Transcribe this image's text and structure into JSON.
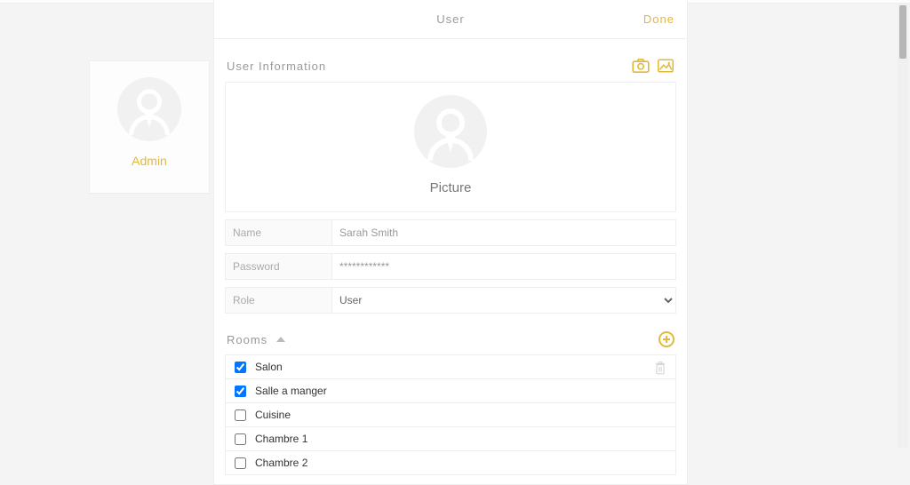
{
  "header": {
    "title": "User",
    "done_label": "Done"
  },
  "sidebar": {
    "role_label": "Admin"
  },
  "user_info": {
    "section_title": "User Information",
    "picture_caption": "Picture",
    "fields": {
      "name_label": "Name",
      "name_value": "Sarah Smith",
      "password_label": "Password",
      "password_value": "************",
      "role_label": "Role",
      "role_value": "User"
    }
  },
  "rooms": {
    "section_title": "Rooms",
    "items": [
      {
        "label": "Salon",
        "checked": true,
        "show_trash": true
      },
      {
        "label": "Salle a manger",
        "checked": true,
        "show_trash": false
      },
      {
        "label": "Cuisine",
        "checked": false,
        "show_trash": false
      },
      {
        "label": "Chambre 1",
        "checked": false,
        "show_trash": false
      },
      {
        "label": "Chambre 2",
        "checked": false,
        "show_trash": false
      }
    ]
  },
  "colors": {
    "accent": "#e2b93a"
  }
}
